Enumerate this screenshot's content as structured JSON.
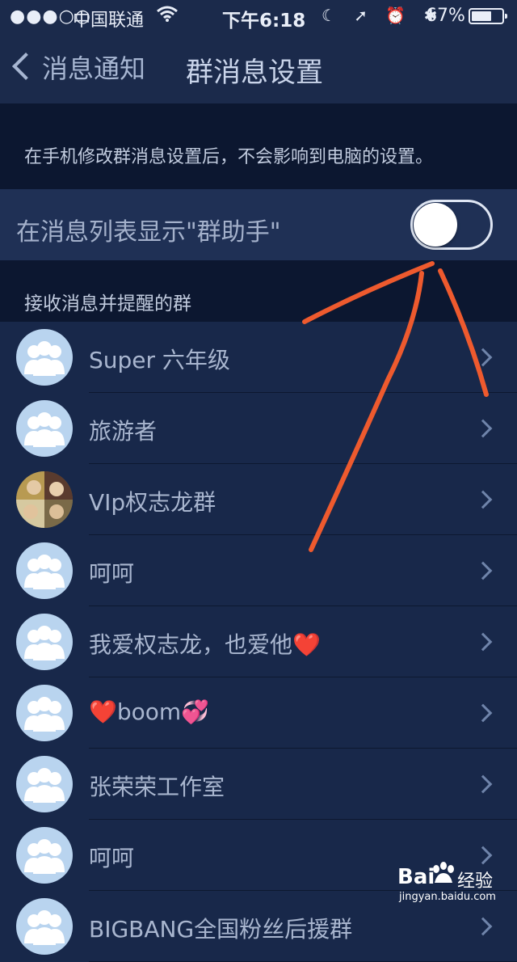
{
  "status_bar": {
    "signal": "●●●○○",
    "carrier": "中国联通",
    "wifi_icon": "wifi-icon",
    "time": "下午6:18",
    "status_icons": "☾ ➚ ⏰ ✱",
    "battery": "67%",
    "battery_level": 0.67
  },
  "nav": {
    "back_label": "消息通知",
    "title": "群消息设置"
  },
  "hint": "在手机修改群消息设置后，不会影响到电脑的设置。",
  "toggle": {
    "label": "在消息列表显示\"群助手\"",
    "on": false
  },
  "section_header": "接收消息并提醒的群",
  "groups": [
    {
      "name": "Super 六年级",
      "avatar": "default-group-avatar"
    },
    {
      "name": "旅游者",
      "avatar": "default-group-avatar"
    },
    {
      "name": "VIp权志龙群",
      "avatar": "photo-avatar"
    },
    {
      "name": "呵呵",
      "avatar": "default-group-avatar"
    },
    {
      "name": "我爱权志龙，也爱他❤️",
      "avatar": "default-group-avatar"
    },
    {
      "name": "❤️boom💞",
      "avatar": "default-group-avatar"
    },
    {
      "name": "张荣荣工作室",
      "avatar": "default-group-avatar"
    },
    {
      "name": "呵呵",
      "avatar": "default-group-avatar"
    },
    {
      "name": "BIGBANG全国粉丝后援群",
      "avatar": "default-group-avatar"
    }
  ],
  "watermark": {
    "brand_prefix": "Bai",
    "brand_suffix": "经验",
    "url": "jingyan.baidu.com"
  },
  "colors": {
    "background": "#14233f",
    "annotation_arrow": "#ee5a2e",
    "avatar_bg": "#b9d4ef"
  }
}
